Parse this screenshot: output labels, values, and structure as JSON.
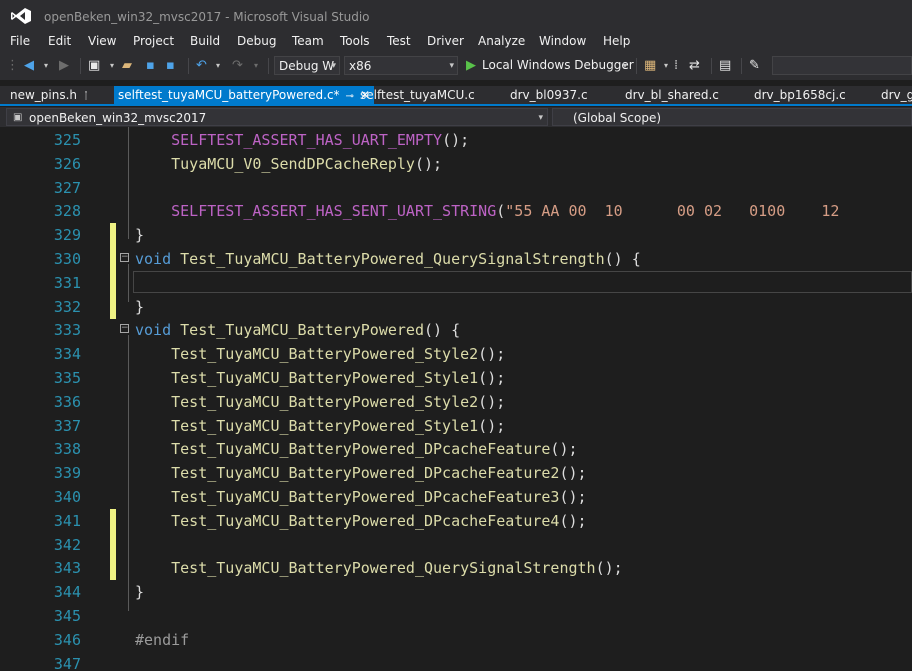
{
  "window": {
    "title": "openBeken_win32_mvsc2017 - Microsoft Visual Studio"
  },
  "menu": [
    "File",
    "Edit",
    "View",
    "Project",
    "Build",
    "Debug",
    "Team",
    "Tools",
    "Test",
    "Driver",
    "Analyze",
    "Window",
    "Help"
  ],
  "toolbar": {
    "configuration": "Debug W",
    "platform": "x86",
    "debugger": "Local Windows Debugger"
  },
  "tabs": [
    {
      "label": "new_pins.h"
    },
    {
      "label": "selftest_tuyaMCU_batteryPowered.c*",
      "active": true
    },
    {
      "label": "selftest_tuyaMCU.c"
    },
    {
      "label": "drv_bl0937.c"
    },
    {
      "label": "drv_bl_shared.c"
    },
    {
      "label": "drv_bp1658cj.c"
    },
    {
      "label": "drv_gi"
    }
  ],
  "navbar": {
    "project": "openBeken_win32_mvsc2017",
    "scope": "(Global Scope)"
  },
  "code_lines": [
    {
      "num": "325",
      "indent": "    ",
      "parts": [
        {
          "t": "SELFTEST_ASSERT_HAS_UART_EMPTY",
          "c": "macro"
        },
        {
          "t": "();",
          "c": "punc"
        }
      ]
    },
    {
      "num": "326",
      "indent": "    ",
      "parts": [
        {
          "t": "TuyaMCU_V0_SendDPCacheReply",
          "c": "fn"
        },
        {
          "t": "();",
          "c": "punc"
        }
      ]
    },
    {
      "num": "327",
      "indent": "",
      "parts": []
    },
    {
      "num": "328",
      "indent": "    ",
      "parts": [
        {
          "t": "SELFTEST_ASSERT_HAS_SENT_UART_STRING",
          "c": "macro"
        },
        {
          "t": "(",
          "c": "punc"
        },
        {
          "t": "\"55 AA 00  10      00 02   0100    12",
          "c": "str"
        }
      ]
    },
    {
      "num": "329",
      "indent": "",
      "parts": [
        {
          "t": "}",
          "c": "punc"
        }
      ],
      "change": true
    },
    {
      "num": "330",
      "indent": "",
      "parts": [
        {
          "t": "void",
          "c": "kw"
        },
        {
          "t": " ",
          "c": "punc"
        },
        {
          "t": "Test_TuyaMCU_BatteryPowered_QuerySignalStrength",
          "c": "fn"
        },
        {
          "t": "() {",
          "c": "punc"
        }
      ],
      "change": true,
      "fold": true
    },
    {
      "num": "331",
      "indent": "",
      "parts": [],
      "change": true,
      "current": true
    },
    {
      "num": "332",
      "indent": "",
      "parts": [
        {
          "t": "}",
          "c": "punc"
        }
      ],
      "change": true
    },
    {
      "num": "333",
      "indent": "",
      "parts": [
        {
          "t": "void",
          "c": "kw"
        },
        {
          "t": " ",
          "c": "punc"
        },
        {
          "t": "Test_TuyaMCU_BatteryPowered",
          "c": "fn"
        },
        {
          "t": "() {",
          "c": "punc"
        }
      ],
      "fold": true
    },
    {
      "num": "334",
      "indent": "    ",
      "parts": [
        {
          "t": "Test_TuyaMCU_BatteryPowered_Style2",
          "c": "fn"
        },
        {
          "t": "();",
          "c": "punc"
        }
      ]
    },
    {
      "num": "335",
      "indent": "    ",
      "parts": [
        {
          "t": "Test_TuyaMCU_BatteryPowered_Style1",
          "c": "fn"
        },
        {
          "t": "();",
          "c": "punc"
        }
      ]
    },
    {
      "num": "336",
      "indent": "    ",
      "parts": [
        {
          "t": "Test_TuyaMCU_BatteryPowered_Style2",
          "c": "fn"
        },
        {
          "t": "();",
          "c": "punc"
        }
      ]
    },
    {
      "num": "337",
      "indent": "    ",
      "parts": [
        {
          "t": "Test_TuyaMCU_BatteryPowered_Style1",
          "c": "fn"
        },
        {
          "t": "();",
          "c": "punc"
        }
      ]
    },
    {
      "num": "338",
      "indent": "    ",
      "parts": [
        {
          "t": "Test_TuyaMCU_BatteryPowered_DPcacheFeature",
          "c": "fn"
        },
        {
          "t": "();",
          "c": "punc"
        }
      ]
    },
    {
      "num": "339",
      "indent": "    ",
      "parts": [
        {
          "t": "Test_TuyaMCU_BatteryPowered_DPcacheFeature2",
          "c": "fn"
        },
        {
          "t": "();",
          "c": "punc"
        }
      ]
    },
    {
      "num": "340",
      "indent": "    ",
      "parts": [
        {
          "t": "Test_TuyaMCU_BatteryPowered_DPcacheFeature3",
          "c": "fn"
        },
        {
          "t": "();",
          "c": "punc"
        }
      ]
    },
    {
      "num": "341",
      "indent": "    ",
      "parts": [
        {
          "t": "Test_TuyaMCU_BatteryPowered_DPcacheFeature4",
          "c": "fn"
        },
        {
          "t": "();",
          "c": "punc"
        }
      ],
      "change": true
    },
    {
      "num": "342",
      "indent": "",
      "parts": [],
      "change": true
    },
    {
      "num": "343",
      "indent": "    ",
      "parts": [
        {
          "t": "Test_TuyaMCU_BatteryPowered_QuerySignalStrength",
          "c": "fn"
        },
        {
          "t": "();",
          "c": "punc"
        }
      ],
      "change": true
    },
    {
      "num": "344",
      "indent": "",
      "parts": [
        {
          "t": "}",
          "c": "punc"
        }
      ]
    },
    {
      "num": "345",
      "indent": "",
      "parts": []
    },
    {
      "num": "346",
      "indent": "",
      "parts": [
        {
          "t": "#endif",
          "c": "pre"
        }
      ]
    },
    {
      "num": "347",
      "indent": "",
      "parts": []
    }
  ]
}
